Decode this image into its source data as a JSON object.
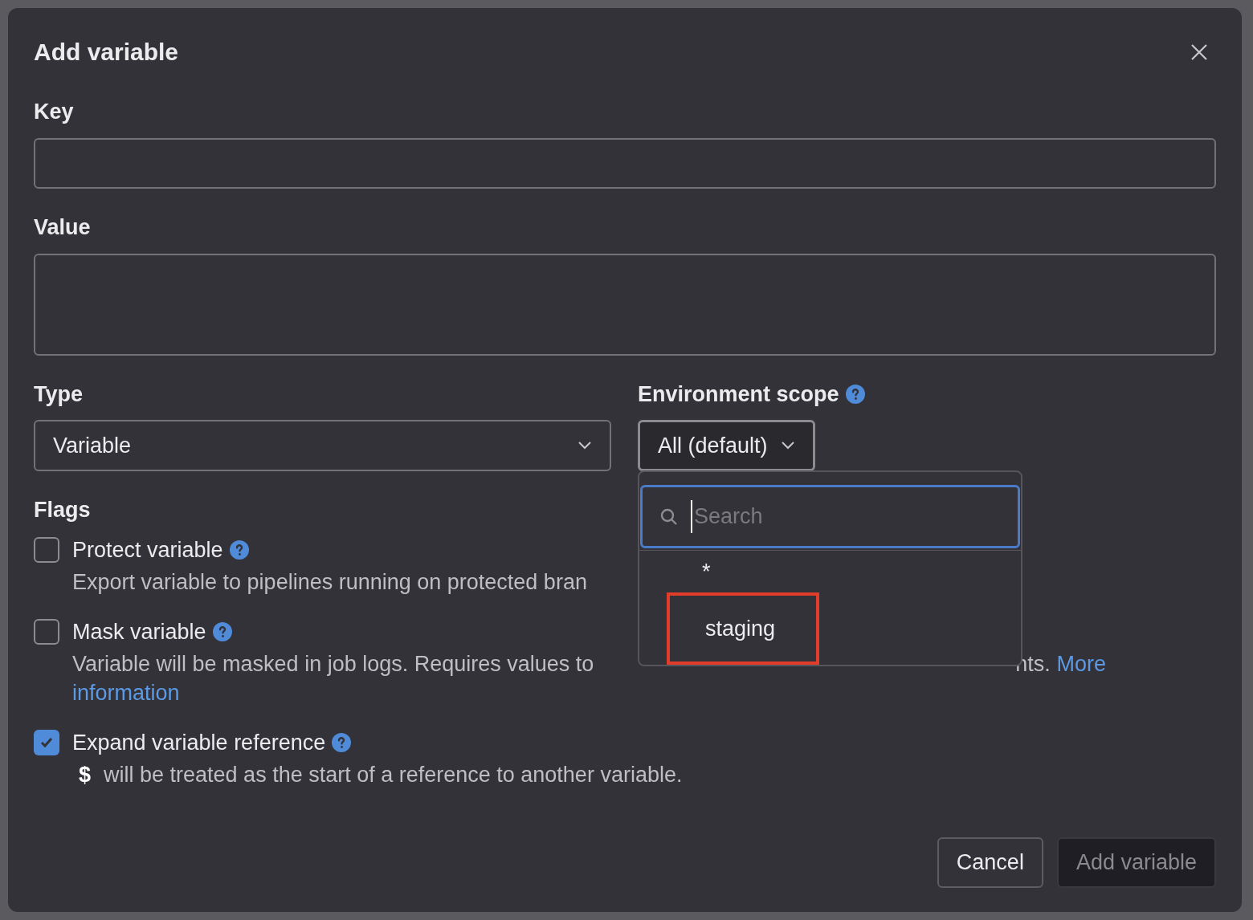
{
  "dialog": {
    "title": "Add variable"
  },
  "key": {
    "label": "Key"
  },
  "value": {
    "label": "Value"
  },
  "type": {
    "label": "Type",
    "value": "Variable"
  },
  "environment_scope": {
    "label": "Environment scope",
    "value": "All (default)",
    "expanded": true
  },
  "dropdown": {
    "search_placeholder": "Search",
    "options": [
      {
        "label": "*",
        "highlighted": false
      },
      {
        "label": "staging",
        "highlighted": true
      }
    ]
  },
  "flags": {
    "label": "Flags",
    "items": [
      {
        "label": "Protect variable",
        "checked": false,
        "description": "Export variable to pipelines running on protected bran"
      },
      {
        "label": "Mask variable",
        "checked": false,
        "description": "Variable will be masked in job logs. Requires values to",
        "description_tail": "nts.",
        "link_lines": [
          "More",
          "information"
        ]
      },
      {
        "label": "Expand variable reference",
        "checked": true,
        "code": "$",
        "description": "will be treated as the start of a reference to another variable."
      }
    ]
  },
  "buttons": [
    {
      "label": "Cancel",
      "kind": "secondary"
    },
    {
      "label": "Add variable",
      "kind": "primary",
      "disabled": true
    }
  ]
}
